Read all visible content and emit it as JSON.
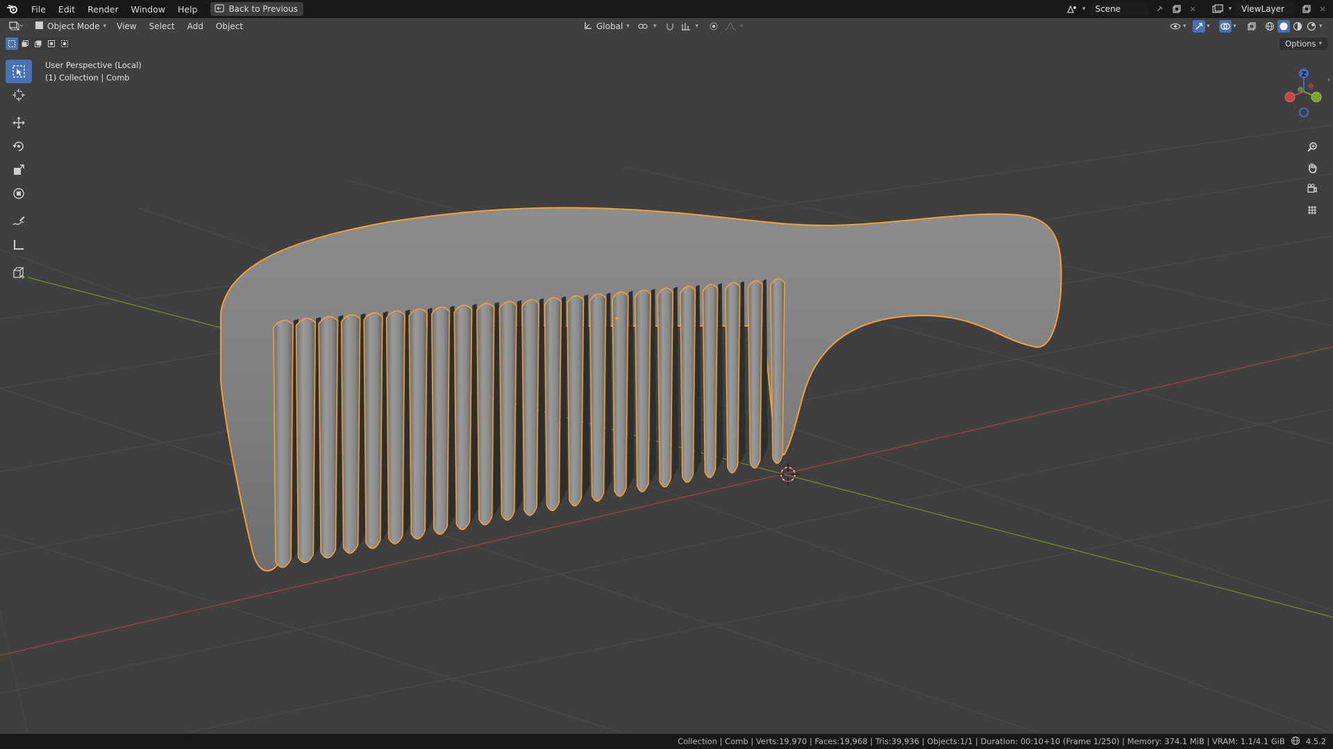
{
  "topbar": {
    "menus": [
      "File",
      "Edit",
      "Render",
      "Window",
      "Help"
    ],
    "back_label": "Back to Previous",
    "scene_name": "Scene",
    "view_layer": "ViewLayer"
  },
  "viewport_header": {
    "mode": "Object Mode",
    "menus": [
      "View",
      "Select",
      "Add",
      "Object"
    ],
    "transform_orientation": "Global",
    "options_label": "Options"
  },
  "overlay": {
    "line1": "User Perspective (Local)",
    "line2": "(1) Collection | Comb"
  },
  "gizmo": {
    "z_label": "Z"
  },
  "statusbar": {
    "text": "Collection | Comb | Verts:19,970 | Faces:19,968 | Tris:39,936 | Objects:1/1 | Duration: 00:10+10 (Frame 1/250) | Memory: 374.1 MiB | VRAM: 1.1/4.1 GiB",
    "version": "4.5.2"
  },
  "colors": {
    "accent": "#4772b3",
    "selection_outline": "#f5a033",
    "x_axis": "#c24848",
    "y_axis": "#7a9a2a"
  },
  "icons": {
    "logo": "blender-logo-icon",
    "back": "back-icon",
    "editor_type": "3d-viewport-icon",
    "tools": [
      "select-box-icon",
      "cursor-icon",
      "move-icon",
      "rotate-icon",
      "scale-icon",
      "transform-icon",
      "annotate-icon",
      "measure-icon",
      "add-cube-icon"
    ],
    "nav": [
      "zoom-icon",
      "pan-hand-icon",
      "camera-icon",
      "grid-icon"
    ]
  }
}
